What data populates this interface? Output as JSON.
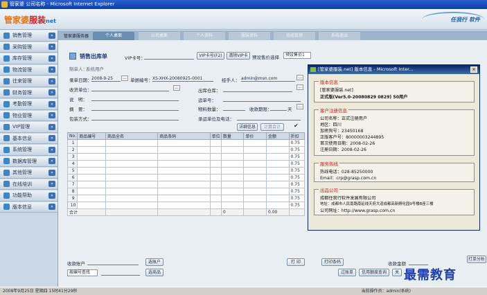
{
  "window": {
    "title": "管家婆 公司名称 - Microsoft Internet Explorer"
  },
  "header": {
    "logo_cn": "管家婆",
    "logo_mid": "服装",
    "logo_en": "net",
    "brand": "任我行 软件"
  },
  "sidebar": {
    "items": [
      {
        "label": "销售管理"
      },
      {
        "label": "采购管理"
      },
      {
        "label": "库存管理"
      },
      {
        "label": "物流管理"
      },
      {
        "label": "往来管理"
      },
      {
        "label": "财务管理"
      },
      {
        "label": "考勤管理"
      },
      {
        "label": "物业管理"
      },
      {
        "label": "VIP管理"
      },
      {
        "label": "基本信息"
      },
      {
        "label": "系统管理"
      },
      {
        "label": "数据库管理"
      },
      {
        "label": "其他管理"
      },
      {
        "label": "在线培训"
      },
      {
        "label": "功能帮助"
      },
      {
        "label": "版本信息"
      }
    ]
  },
  "tabbar": {
    "lead": "管家婆服务器",
    "tabs": [
      "个人桌面",
      "公司桌面",
      "个人资料",
      "服装资料",
      "班组管理",
      "系统退出"
    ]
  },
  "form": {
    "title": "销售出库单",
    "creator_label": "制单人：",
    "creator_value": "系统用户",
    "vip_label": "VIP卡号：",
    "vip_btn": "VIP卡号(F2)",
    "clear_vip_btn": "清除VIP卡",
    "price_select_label": "预设售价选择",
    "price_select_value": "预设售价1",
    "date_label": "录单日期：",
    "date_value": "2008-9-25",
    "doc_no_label": "单据编号：",
    "doc_no_value": "XS-XHX-20080925-0001",
    "handler_label": "经手人：",
    "handler_value": "admin@msn.com",
    "recv_unit_label": "收货单位：",
    "warehouse_label": "出库仓库：",
    "summary_label": "说　明：",
    "shipno_label": "运单号：",
    "abstract_label": "摘　要：",
    "logistics_label": "物料数量：",
    "payment_label": "收款期限：",
    "payment_unit": "天",
    "packing_label": "包装方式：",
    "carrier_label": "承运单位及电话：",
    "detail_btn": "详细信息",
    "calc_btn": "计算合计",
    "grid": {
      "headers": [
        "No.",
        "商品编号",
        "商品全名",
        "商品条码",
        "单位",
        "数量",
        "单价",
        "金额",
        "折扣"
      ],
      "rows": [
        [
          "1",
          "",
          "",
          "",
          "",
          "",
          "",
          "",
          "0.75"
        ],
        [
          "2",
          "",
          "",
          "",
          "",
          "",
          "",
          "",
          "0.75"
        ],
        [
          "3",
          "",
          "",
          "",
          "",
          "",
          "",
          "",
          "0.75"
        ],
        [
          "4",
          "",
          "",
          "",
          "",
          "",
          "",
          "",
          "0.75"
        ],
        [
          "5",
          "",
          "",
          "",
          "",
          "",
          "",
          "",
          "0.75"
        ],
        [
          "6",
          "",
          "",
          "",
          "",
          "",
          "",
          "",
          "0.75"
        ],
        [
          "7",
          "",
          "",
          "",
          "",
          "",
          "",
          "",
          "0.75"
        ],
        [
          "8",
          "",
          "",
          "",
          "",
          "",
          "",
          "",
          "0.75"
        ],
        [
          "9",
          "",
          "",
          "",
          "",
          "",
          "",
          "",
          "0.75"
        ],
        [
          "10",
          "",
          "",
          "",
          "",
          "",
          "",
          "",
          "0.75"
        ]
      ],
      "total_label": "合计",
      "total_qty": "0",
      "total_amount": "0.00"
    },
    "account_label": "收款账户",
    "select_account_btn": "选账户",
    "print_btn": "打 印",
    "print_barcode_btn": "打印条码",
    "collect_label": "收款金额",
    "search_select": "按编号查找",
    "select_goods_btn": "选商品",
    "post_btn": "过账单",
    "credit_btn": "信用额度查询",
    "close_btn": "关",
    "more_btn": "打单分析"
  },
  "dialog": {
    "title": "[管家婆服装.net] 版本信息 - Microsoft Inter...",
    "close": "×",
    "groups": [
      {
        "label": "版本信息",
        "lines": [
          "[管家婆服装.net]",
          "正式版(Ver5.0-20080829 0829) 50用户"
        ]
      },
      {
        "label": "客户注册信息",
        "lines": [
          "公司名称：正式注册用户",
          "地区：四川",
          "加密狗号：23450168",
          "正版客户号：80000003244895",
          "首次使用日期：2008-02-26",
          "注册日期：2008-02-26"
        ]
      },
      {
        "label": "服务热线",
        "lines": [
          "热线电话：028-85250000",
          "Email：crp@grasp.com.cn"
        ]
      },
      {
        "label": "出品公司",
        "lines": [
          "成都任我行软件发展有限公司",
          "地址：成都市人民南路南延线天府大道成都高新孵化园9号楼B座三楼",
          "公司网址：http://www.grasp.com.cn"
        ]
      }
    ]
  },
  "statusbar": {
    "left": "2008年9月25日 星期四 15时41分29秒",
    "right": "当前操作员：admin(系统)"
  },
  "watermark": "最需教育"
}
